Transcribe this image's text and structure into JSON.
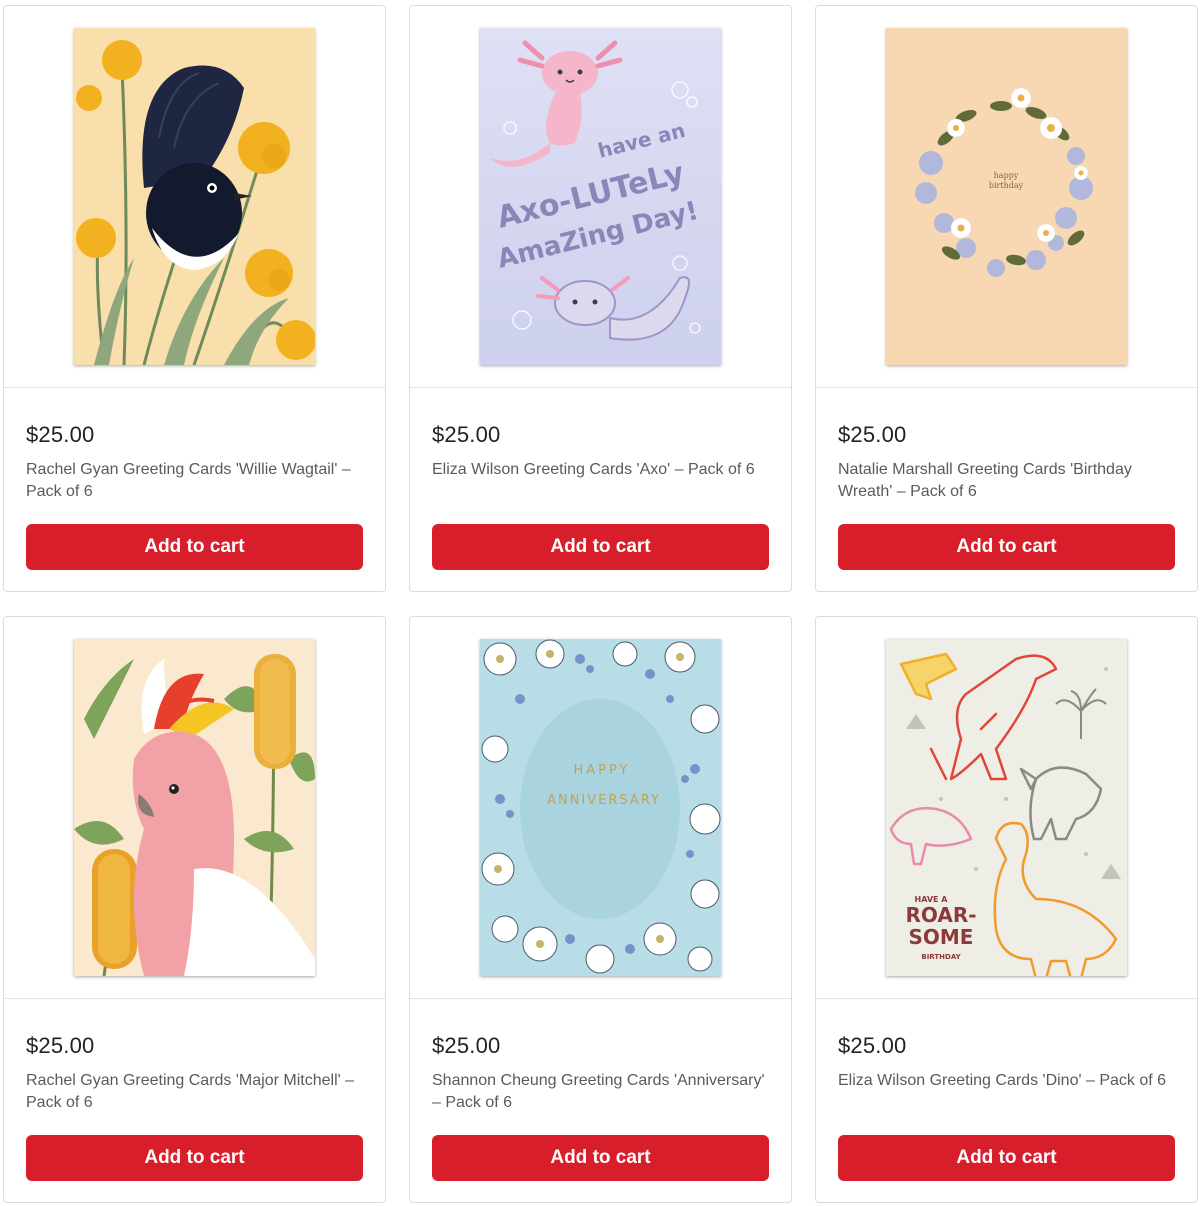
{
  "products": [
    {
      "price": "$25.00",
      "title": "Rachel Gyan Greeting Cards 'Willie Wagtail' – Pack of 6",
      "button_label": "Add to cart",
      "image_icon": "willie-wagtail-card-art"
    },
    {
      "price": "$25.00",
      "title": "Eliza Wilson Greeting Cards 'Axo' – Pack of 6",
      "button_label": "Add to cart",
      "image_icon": "axolotl-card-art",
      "card_text": [
        "have an",
        "Axo-LUTeLy",
        "AmaZing Day!"
      ]
    },
    {
      "price": "$25.00",
      "title": "Natalie Marshall Greeting Cards 'Birthday Wreath' – Pack of 6",
      "button_label": "Add to cart",
      "image_icon": "birthday-wreath-card-art",
      "card_text": [
        "happy",
        "birthday"
      ]
    },
    {
      "price": "$25.00",
      "title": "Rachel Gyan Greeting Cards 'Major Mitchell' – Pack of 6",
      "button_label": "Add to cart",
      "image_icon": "major-mitchell-cockatoo-card-art"
    },
    {
      "price": "$25.00",
      "title": "Shannon Cheung Greeting Cards 'Anniversary' – Pack of 6",
      "button_label": "Add to cart",
      "image_icon": "anniversary-flowers-card-art",
      "card_text": [
        "HAPPY",
        "ANNIVERSARY"
      ]
    },
    {
      "price": "$25.00",
      "title": "Eliza Wilson Greeting Cards 'Dino' – Pack of 6",
      "button_label": "Add to cart",
      "image_icon": "dinosaur-card-art",
      "card_text": [
        "HAVE A",
        "ROAR-",
        "SOME",
        "BIRTHDAY"
      ]
    }
  ],
  "colors": {
    "button": "#d81e2a",
    "button_text": "#ffffff",
    "price_text": "#222222",
    "title_text": "#5a5a5a"
  }
}
